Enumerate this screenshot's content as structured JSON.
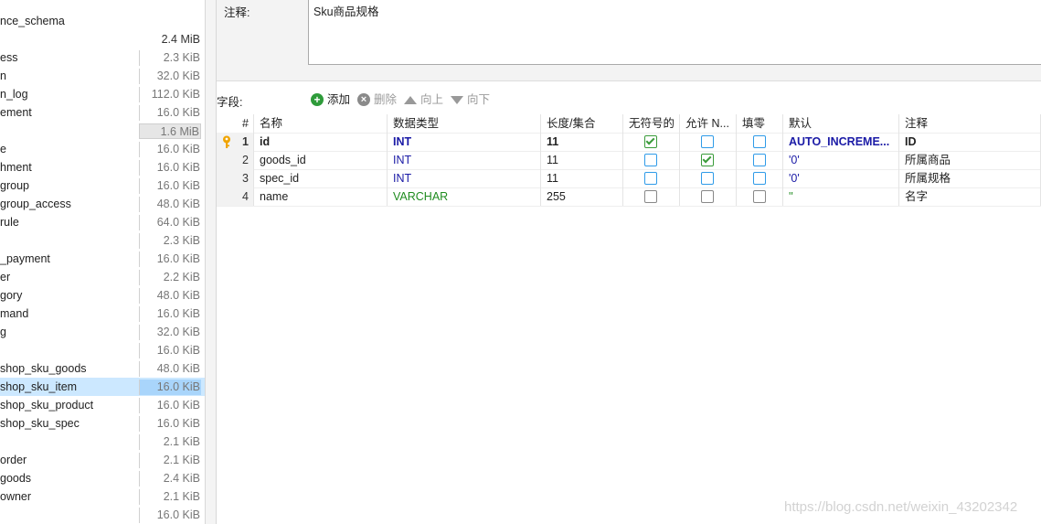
{
  "tree": {
    "items": [
      {
        "name": "nce_schema",
        "size": ""
      },
      {
        "name": "",
        "size": "2.4 MiB",
        "style": "plain"
      },
      {
        "name": "ess",
        "size": "2.3 KiB"
      },
      {
        "name": "n",
        "size": "32.0 KiB"
      },
      {
        "name": "n_log",
        "size": "112.0 KiB"
      },
      {
        "name": "ement",
        "size": "16.0 KiB"
      },
      {
        "name": "",
        "size": "1.6 MiB",
        "style": "hl"
      },
      {
        "name": "e",
        "size": "16.0 KiB"
      },
      {
        "name": "hment",
        "size": "16.0 KiB"
      },
      {
        "name": "group",
        "size": "16.0 KiB"
      },
      {
        "name": "group_access",
        "size": "48.0 KiB"
      },
      {
        "name": "rule",
        "size": "64.0 KiB"
      },
      {
        "name": "",
        "size": "2.3 KiB"
      },
      {
        "name": "_payment",
        "size": "16.0 KiB"
      },
      {
        "name": "er",
        "size": "2.2 KiB"
      },
      {
        "name": "gory",
        "size": "48.0 KiB"
      },
      {
        "name": "mand",
        "size": "16.0 KiB"
      },
      {
        "name": "g",
        "size": "32.0 KiB"
      },
      {
        "name": "",
        "size": "16.0 KiB"
      },
      {
        "name": "shop_sku_goods",
        "size": "48.0 KiB"
      },
      {
        "name": "shop_sku_item",
        "size": "16.0 KiB",
        "selected": true
      },
      {
        "name": "shop_sku_product",
        "size": "16.0 KiB"
      },
      {
        "name": "shop_sku_spec",
        "size": "16.0 KiB"
      },
      {
        "name": "",
        "size": "2.1 KiB"
      },
      {
        "name": "order",
        "size": "2.1 KiB"
      },
      {
        "name": "goods",
        "size": "2.4 KiB"
      },
      {
        "name": "owner",
        "size": "2.1 KiB"
      },
      {
        "name": "",
        "size": "16.0 KiB"
      }
    ]
  },
  "comment": {
    "label": "注释:",
    "value": "Sku商品规格"
  },
  "fields": {
    "label": "字段:",
    "toolbar": {
      "add": "添加",
      "delete": "删除",
      "up": "向上",
      "down": "向下"
    },
    "columns": [
      "#",
      "名称",
      "数据类型",
      "长度/集合",
      "无符号的",
      "允许 N...",
      "填零",
      "默认",
      "注释"
    ],
    "rows": [
      {
        "num": "1",
        "name": "id",
        "type": "INT",
        "length": "11",
        "unsigned": true,
        "allow_null": false,
        "zerofill": false,
        "default": "AUTO_INCREME...",
        "comment": "ID",
        "primary": true
      },
      {
        "num": "2",
        "name": "goods_id",
        "type": "INT",
        "length": "11",
        "unsigned": false,
        "allow_null": true,
        "zerofill": false,
        "default": "'0'",
        "comment": "所属商品"
      },
      {
        "num": "3",
        "name": "spec_id",
        "type": "INT",
        "length": "11",
        "unsigned": false,
        "allow_null": false,
        "zerofill": false,
        "default": "'0'",
        "comment": "所属规格"
      },
      {
        "num": "4",
        "name": "name",
        "type": "VARCHAR",
        "length": "255",
        "unsigned": false,
        "allow_null": false,
        "zerofill": false,
        "default": "''",
        "comment": "名字"
      }
    ]
  },
  "watermark": "https://blog.csdn.net/weixin_43202342",
  "colors": {
    "selection": "#cce8ff",
    "int_type": "#1a1aa6",
    "varchar_type": "#1f8c1f",
    "add_icon": "#2e9b3a",
    "delete_icon": "#8a8a8a"
  }
}
